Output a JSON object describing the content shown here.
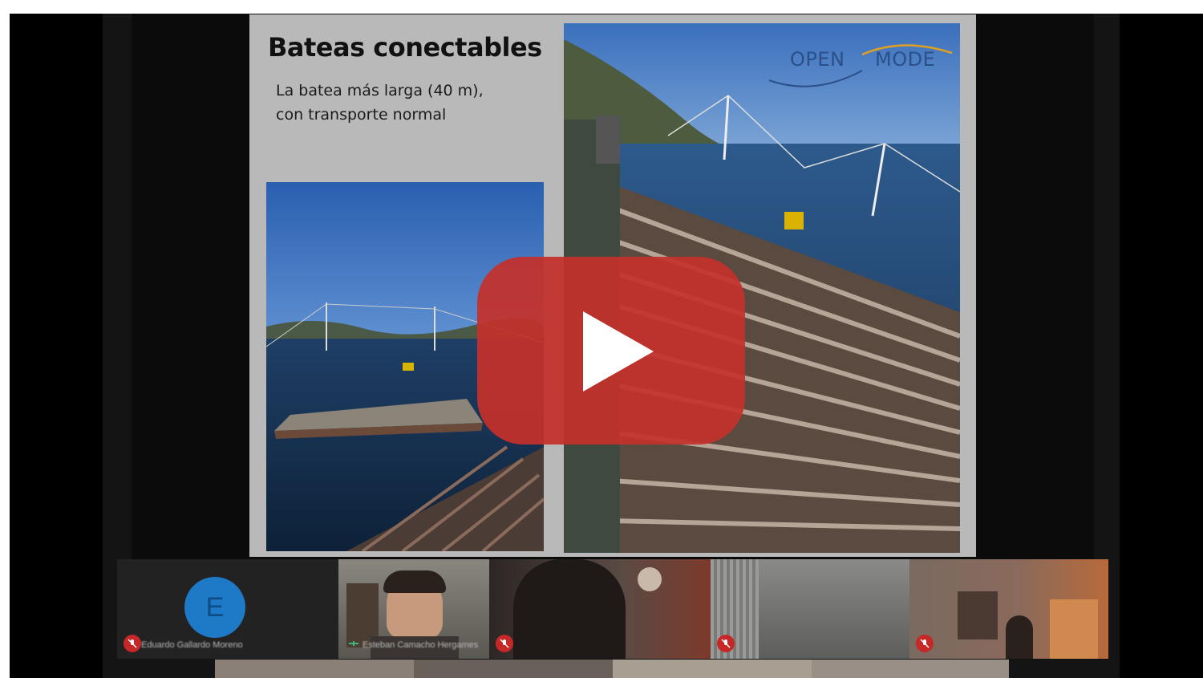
{
  "slide": {
    "title": "Bateas conectables",
    "subtitle_lines": [
      "La batea más larga (40 m),",
      "con transporte normal"
    ],
    "logo": {
      "word1": "OPEN",
      "word2": "MODE"
    }
  },
  "play_button": {
    "color": "#c4302b",
    "icon": "play-icon"
  },
  "participants": [
    {
      "name": "Eduardo Gallardo Moreno",
      "initial": "E",
      "muted": true
    },
    {
      "name": "Esteban Camacho Hergames",
      "muted": false
    },
    {
      "name": "",
      "muted": true
    },
    {
      "name": "",
      "muted": true
    },
    {
      "name": "",
      "muted": true
    }
  ]
}
